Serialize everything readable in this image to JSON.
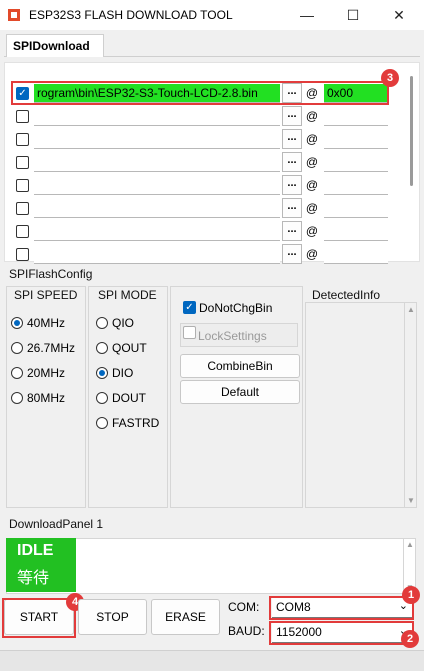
{
  "window": {
    "title": "ESP32S3 FLASH DOWNLOAD TOOL",
    "minimize": "—",
    "maximize": "☐",
    "close": "✕"
  },
  "tabs": [
    {
      "label": "SPIDownload"
    }
  ],
  "file_rows": [
    {
      "checked": true,
      "path": "rogram\\bin\\ESP32-S3-Touch-LCD-2.8.bin",
      "browse": "...",
      "at": "@",
      "address": "0x00"
    },
    {
      "checked": false,
      "path": "",
      "browse": "...",
      "at": "@",
      "address": ""
    },
    {
      "checked": false,
      "path": "",
      "browse": "...",
      "at": "@",
      "address": ""
    },
    {
      "checked": false,
      "path": "",
      "browse": "...",
      "at": "@",
      "address": ""
    },
    {
      "checked": false,
      "path": "",
      "browse": "...",
      "at": "@",
      "address": ""
    },
    {
      "checked": false,
      "path": "",
      "browse": "...",
      "at": "@",
      "address": ""
    },
    {
      "checked": false,
      "path": "",
      "browse": "...",
      "at": "@",
      "address": ""
    },
    {
      "checked": false,
      "path": "",
      "browse": "...",
      "at": "@",
      "address": ""
    }
  ],
  "spi_flash_config": {
    "label": "SPIFlashConfig",
    "spi_speed": {
      "label": "SPI SPEED",
      "options": [
        "40MHz",
        "26.7MHz",
        "20MHz",
        "80MHz"
      ],
      "selected": "40MHz"
    },
    "spi_mode": {
      "label": "SPI MODE",
      "options": [
        "QIO",
        "QOUT",
        "DIO",
        "DOUT",
        "FASTRD"
      ],
      "selected": "DIO"
    },
    "do_not_chg_bin": {
      "label": "DoNotChgBin",
      "checked": true
    },
    "lock_settings": {
      "label": "LockSettings",
      "checked": false
    },
    "combine_bin": "CombineBin",
    "default": "Default",
    "detected_info": "DetectedInfo"
  },
  "download_panel": {
    "label": "DownloadPanel 1",
    "status_en": "IDLE",
    "status_cn": "等待"
  },
  "buttons": {
    "start": "START",
    "stop": "STOP",
    "erase": "ERASE"
  },
  "com": {
    "label": "COM:",
    "value": "COM8"
  },
  "baud": {
    "label": "BAUD:",
    "value": "1152000"
  },
  "annotations": {
    "one": "1",
    "two": "2",
    "three": "3",
    "four": "4"
  },
  "colors": {
    "highlight_green": "#22e022",
    "idle_green": "#22c022",
    "annotation_red": "#e23b3b",
    "accent_blue": "#0067c0"
  }
}
